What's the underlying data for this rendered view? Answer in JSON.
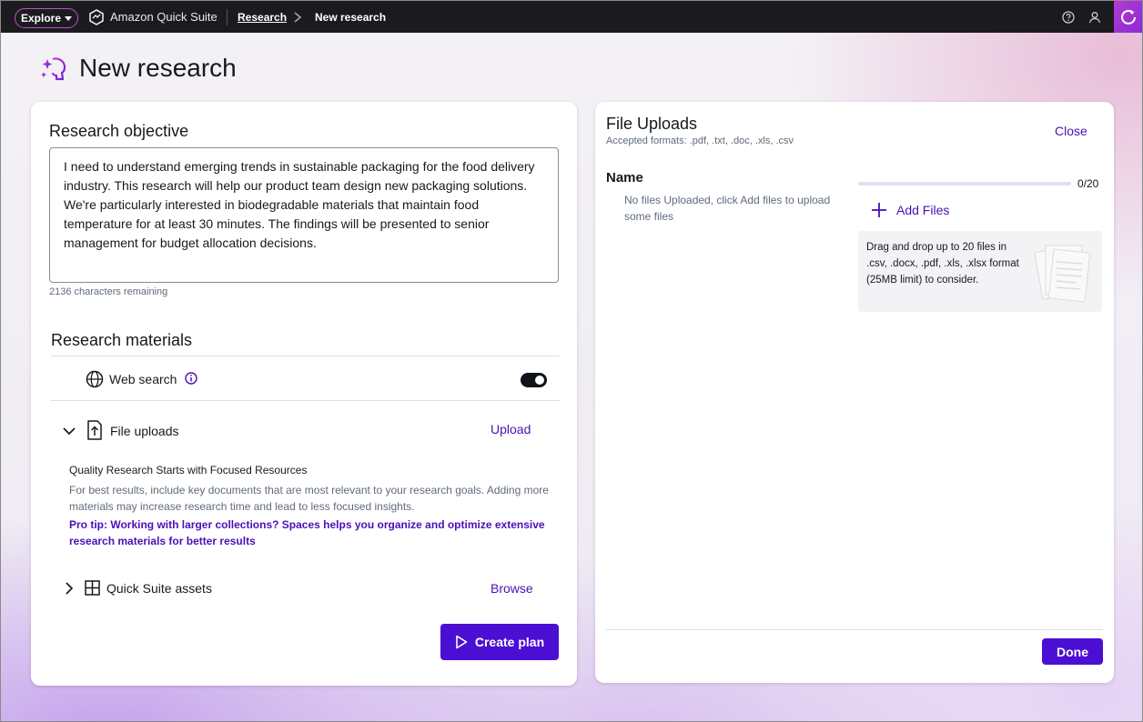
{
  "topbar": {
    "explore_label": "Explore",
    "app_name": "Amazon Quick Suite",
    "breadcrumb": [
      "Research",
      "New research"
    ]
  },
  "page": {
    "title": "New research"
  },
  "objective": {
    "title": "Research objective",
    "text": "I need to understand emerging trends in sustainable packaging for the food delivery industry. This research will help our product team design new packaging solutions. We're particularly interested in biodegradable materials that maintain food temperature for at least 30 minutes. The findings will be presented to senior management for budget allocation decisions.",
    "chars_remaining": "2136 characters remaining"
  },
  "materials": {
    "title": "Research materials",
    "web_search": {
      "label": "Web search",
      "enabled": true
    },
    "file_uploads": {
      "label": "File uploads",
      "action": "Upload",
      "expanded": true
    },
    "quality_title": "Quality Research Starts with Focused Resources",
    "quality_body": "For best results, include key documents that are most relevant to your research goals. Adding more materials may increase research time and lead to less focused insights.",
    "pro_tip": "Pro tip: Working with larger collections? Spaces helps you organize and optimize extensive research materials for better results",
    "quick_suite_assets": {
      "label": "Quick Suite assets",
      "action": "Browse",
      "expanded": false
    },
    "create_plan_label": "Create plan"
  },
  "file_uploads_panel": {
    "title": "File Uploads",
    "formats": "Accepted formats: .pdf, .txt, .doc, .xls, .csv",
    "close_label": "Close",
    "name_header": "Name",
    "empty_text": "No files Uploaded, click Add files to upload some files",
    "count_label": "0/20",
    "uploaded": 0,
    "max_files": 20,
    "add_files_label": "Add Files",
    "drop_text": "Drag and drop up to 20 files in .csv, .docx, .pdf, .xls, .xlsx format (25MB limit) to consider.",
    "done_label": "Done"
  },
  "colors": {
    "accent": "#4b0fd4",
    "link": "#4b0fb8",
    "topbar": "#1b1b1f"
  }
}
